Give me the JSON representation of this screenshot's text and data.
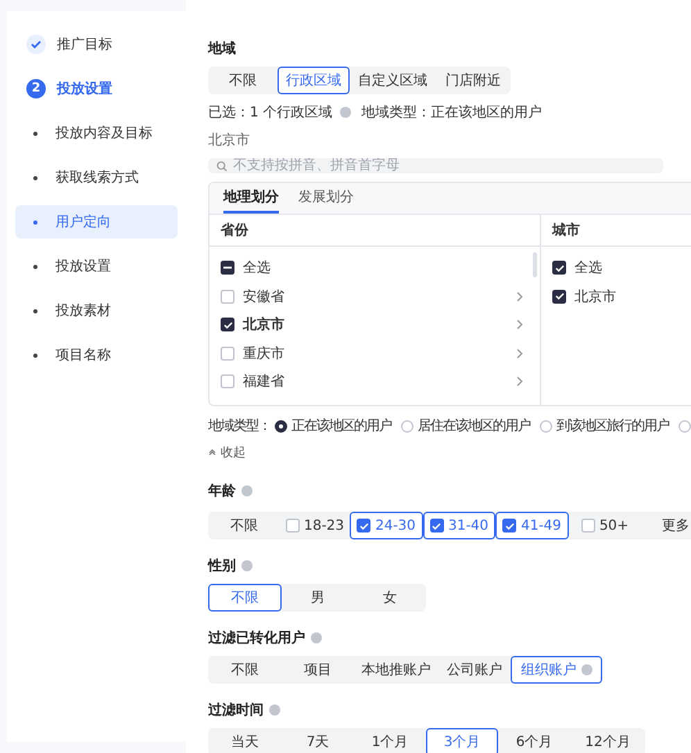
{
  "sidebar": {
    "items": [
      {
        "kind": "done",
        "label": "推广目标",
        "selected": false
      },
      {
        "kind": "step",
        "number": "2",
        "label": "投放设置",
        "selected": false
      },
      {
        "kind": "sub",
        "label": "投放内容及目标",
        "selected": false
      },
      {
        "kind": "sub",
        "label": "获取线索方式",
        "selected": false
      },
      {
        "kind": "sub",
        "label": "用户定向",
        "selected": true
      },
      {
        "kind": "sub",
        "label": "投放设置",
        "selected": false
      },
      {
        "kind": "sub",
        "label": "投放素材",
        "selected": false
      },
      {
        "kind": "sub",
        "label": "项目名称",
        "selected": false
      }
    ]
  },
  "region": {
    "title": "地域",
    "options": [
      {
        "label": "不限",
        "selected": false
      },
      {
        "label": "行政区域",
        "selected": true
      },
      {
        "label": "自定义区域",
        "selected": false
      },
      {
        "label": "门店附近",
        "selected": false
      }
    ],
    "summary_selected": "已选：1 个行政区域",
    "summary_type": "地域类型：正在该地区的用户",
    "selected_text": "北京市",
    "search": {
      "placeholder": "不支持按拼音、拼音首字母"
    },
    "tabs": [
      {
        "label": "地理划分",
        "selected": true
      },
      {
        "label": "发展划分",
        "selected": false
      }
    ],
    "province_header": "省份",
    "city_header": "城市",
    "provinces": [
      {
        "label": "全选",
        "checked": false,
        "indeterminate": true,
        "expandable": false
      },
      {
        "label": "安徽省",
        "checked": false,
        "indeterminate": false,
        "expandable": true
      },
      {
        "label": "北京市",
        "checked": true,
        "indeterminate": false,
        "expandable": true
      },
      {
        "label": "重庆市",
        "checked": false,
        "indeterminate": false,
        "expandable": true
      },
      {
        "label": "福建省",
        "checked": false,
        "indeterminate": false,
        "expandable": true
      }
    ],
    "cities": [
      {
        "label": "全选",
        "checked": true
      },
      {
        "label": "北京市",
        "checked": true
      }
    ],
    "type_label": "地域类型：",
    "types": [
      {
        "label": "正在该地区的用户",
        "selected": true
      },
      {
        "label": "居住在该地区的用户",
        "selected": false
      },
      {
        "label": "到该地区旅行的用户",
        "selected": false
      },
      {
        "selected": false
      }
    ],
    "collapse": "收起"
  },
  "age": {
    "title": "年龄",
    "options": [
      {
        "kind": "plain",
        "label": "不限",
        "selected": false
      },
      {
        "kind": "checkbox",
        "label": "18-23",
        "checked": false
      },
      {
        "kind": "checkbox",
        "label": "24-30",
        "checked": true
      },
      {
        "kind": "checkbox",
        "label": "31-40",
        "checked": true
      },
      {
        "kind": "checkbox",
        "label": "41-49",
        "checked": true
      },
      {
        "kind": "checkbox",
        "label": "50+",
        "checked": false
      },
      {
        "kind": "plain",
        "label": "更多",
        "selected": false
      }
    ]
  },
  "gender": {
    "title": "性别",
    "options": [
      {
        "label": "不限",
        "selected": true
      },
      {
        "label": "男",
        "selected": false
      },
      {
        "label": "女",
        "selected": false
      }
    ]
  },
  "filter_converted": {
    "title": "过滤已转化用户",
    "options": [
      {
        "label": "不限",
        "selected": false,
        "help": false
      },
      {
        "label": "项目",
        "selected": false,
        "help": false
      },
      {
        "label": "本地推账户",
        "selected": false,
        "help": false
      },
      {
        "label": "公司账户",
        "selected": false,
        "help": false
      },
      {
        "label": "组织账户",
        "selected": true,
        "help": true
      }
    ]
  },
  "filter_time": {
    "title": "过滤时间",
    "options": [
      {
        "label": "当天",
        "selected": false
      },
      {
        "label": "7天",
        "selected": false
      },
      {
        "label": "1个月",
        "selected": false
      },
      {
        "label": "3个月",
        "selected": true
      },
      {
        "label": "6个月",
        "selected": false
      },
      {
        "label": "12个月",
        "selected": false
      }
    ]
  }
}
